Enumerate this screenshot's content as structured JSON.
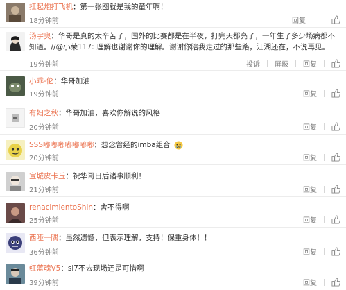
{
  "comments": [
    {
      "user": "扛起炮打飞机",
      "text": "第一张图就是我的童年啊！",
      "time": "18分钟前",
      "reply": "回复",
      "avatar_color": "#8a7a6a"
    },
    {
      "user": "汤宇奥",
      "text": "华哥是真的太辛苦了，国外的比赛都是在半夜，打完天都亮了，一年生了多少场病都不知道。//@小荣117: 理解也谢谢你的理解。谢谢你陪我走过的那些路，江湖还在，不说再见。",
      "time": "19分钟前",
      "report": "投诉",
      "block": "屏蔽",
      "reply": "回复",
      "avatar_color": "#3a3a3a"
    },
    {
      "user": "小乖-伦",
      "text": "华哥加油",
      "time": "19分钟前",
      "reply": "回复",
      "avatar_color": "#4b5a46"
    },
    {
      "user": "有妇之秋",
      "text": "华哥加油，喜欢你解说的风格",
      "time": "20分钟前",
      "reply": "回复",
      "avatar_color": "#d8d8d8"
    },
    {
      "user": "SSS嘟嘟嘟嘟嘟嘟嘟",
      "text": "想念曾经的imba组合",
      "time": "20分钟前",
      "reply": "回复",
      "avatar_color": "#e9d24a"
    },
    {
      "user": "宣城皮卡丘",
      "text": "祝华哥日后诸事顺利！",
      "time": "21分钟前",
      "reply": "回复",
      "avatar_color": "#a8a8a8"
    },
    {
      "user": "renacimientoShin",
      "text": "舍不得啊",
      "time": "25分钟前",
      "reply": "回复",
      "avatar_color": "#6a4a48"
    },
    {
      "user": "西哑一隅",
      "text": "虽然遗憾，但表示理解，支持！保重身体！！",
      "time": "36分钟前",
      "reply": "回复",
      "avatar_color": "#3b3f7a"
    },
    {
      "user": "红蓝魂V5",
      "text": "sl7不去现场还是可惜啊",
      "time": "39分钟前",
      "reply": "回复",
      "avatar_color": "#6a8a9a"
    }
  ]
}
